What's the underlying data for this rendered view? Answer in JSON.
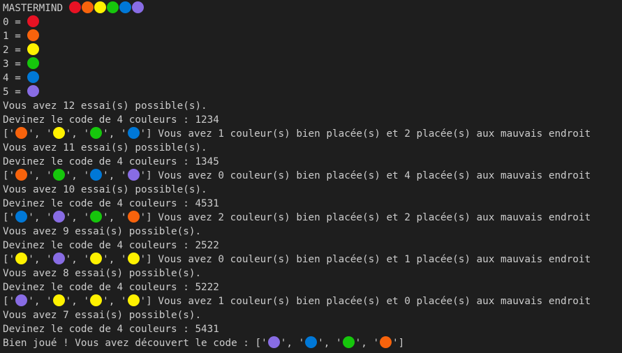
{
  "colors": {
    "red": "#e81224",
    "orange": "#f7630c",
    "yellow": "#fff100",
    "green": "#16c60c",
    "blue": "#0078d7",
    "purple": "#886ce4",
    "background": "#1e1e1e",
    "text": "#cccccc"
  },
  "title": "MASTERMIND",
  "title_dots": [
    "red",
    "orange",
    "yellow",
    "green",
    "blue",
    "purple"
  ],
  "legend": [
    {
      "label": "0 = ",
      "color": "red"
    },
    {
      "label": "1 = ",
      "color": "orange"
    },
    {
      "label": "2 = ",
      "color": "yellow"
    },
    {
      "label": "3 = ",
      "color": "green"
    },
    {
      "label": "4 = ",
      "color": "blue"
    },
    {
      "label": "5 = ",
      "color": "purple"
    }
  ],
  "rounds": [
    {
      "tries": "Vous avez 12 essai(s) possible(s).",
      "guess": "Devinez le code de 4 couleurs : 1234",
      "result_colors": [
        "orange",
        "yellow",
        "green",
        "blue"
      ],
      "feedback": "Vous avez 1 couleur(s) bien placée(s) et 2 placée(s) aux mauvais endroit"
    },
    {
      "tries": "Vous avez 11 essai(s) possible(s).",
      "guess": "Devinez le code de 4 couleurs : 1345",
      "result_colors": [
        "orange",
        "green",
        "blue",
        "purple"
      ],
      "feedback": "Vous avez 0 couleur(s) bien placée(s) et 4 placée(s) aux mauvais endroit"
    },
    {
      "tries": "Vous avez 10 essai(s) possible(s).",
      "guess": "Devinez le code de 4 couleurs : 4531",
      "result_colors": [
        "blue",
        "purple",
        "green",
        "orange"
      ],
      "feedback": "Vous avez 2 couleur(s) bien placée(s) et 2 placée(s) aux mauvais endroit"
    },
    {
      "tries": "Vous avez 9 essai(s) possible(s).",
      "guess": "Devinez le code de 4 couleurs : 2522",
      "result_colors": [
        "yellow",
        "purple",
        "yellow",
        "yellow"
      ],
      "feedback": "Vous avez 0 couleur(s) bien placée(s) et 1 placée(s) aux mauvais endroit"
    },
    {
      "tries": "Vous avez 8 essai(s) possible(s).",
      "guess": "Devinez le code de 4 couleurs : 5222",
      "result_colors": [
        "purple",
        "yellow",
        "yellow",
        "yellow"
      ],
      "feedback": "Vous avez 1 couleur(s) bien placée(s) et 0 placée(s) aux mauvais endroit"
    },
    {
      "tries": "Vous avez 7 essai(s) possible(s).",
      "guess": "Devinez le code de 4 couleurs : 5431",
      "result_colors": null,
      "feedback": null
    }
  ],
  "final": {
    "text": "Bien joué ! Vous avez découvert le code : ",
    "colors": [
      "purple",
      "blue",
      "green",
      "orange"
    ]
  }
}
